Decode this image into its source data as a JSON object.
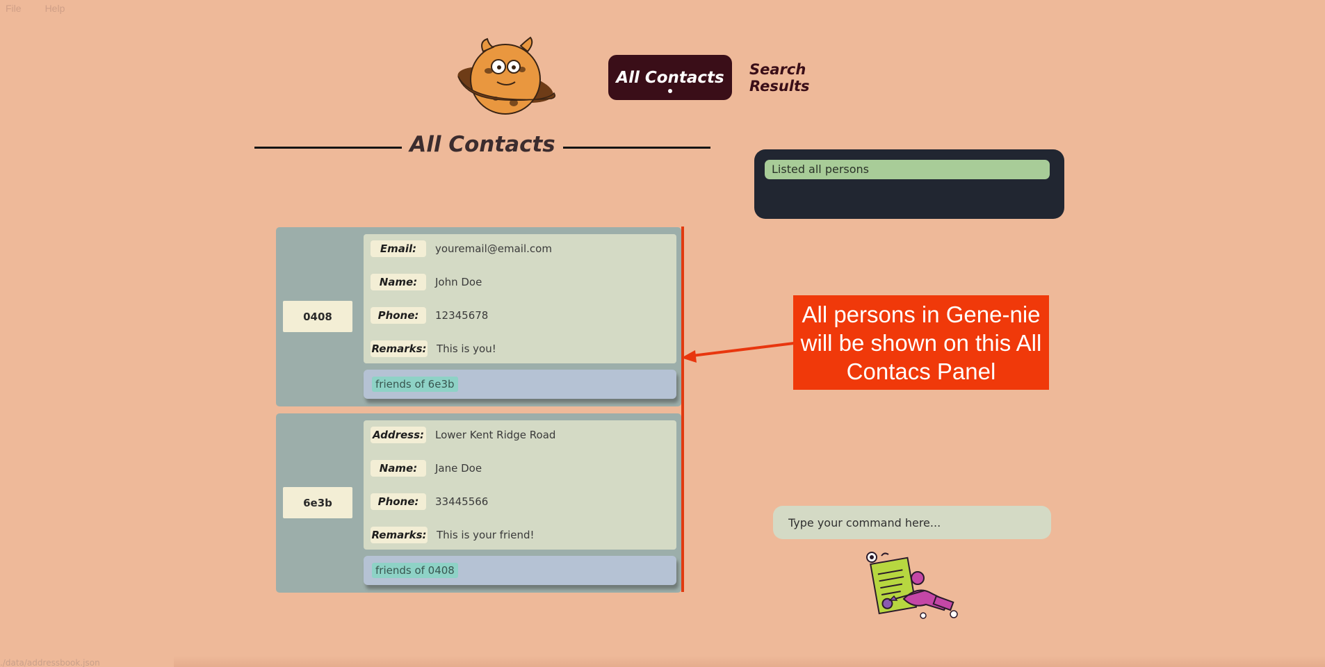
{
  "menu": {
    "items": [
      "File",
      "Help"
    ]
  },
  "nav": {
    "active_tab": "All Contacts",
    "inactive_tab": "Search Results"
  },
  "section": {
    "title": "All Contacts"
  },
  "result_display": {
    "text": "Listed all persons"
  },
  "contacts": [
    {
      "id": "0408",
      "fields": [
        {
          "label": "Email:",
          "value": "youremail@email.com"
        },
        {
          "label": "Name:",
          "value": "John Doe"
        },
        {
          "label": "Phone:",
          "value": "12345678"
        },
        {
          "label": "Remarks:",
          "value": "This is you!"
        }
      ],
      "tag": "friends of 6e3b"
    },
    {
      "id": "6e3b",
      "fields": [
        {
          "label": "Address:",
          "value": "Lower Kent Ridge Road"
        },
        {
          "label": "Name:",
          "value": "Jane Doe"
        },
        {
          "label": "Phone:",
          "value": "33445566"
        },
        {
          "label": "Remarks:",
          "value": "This is your friend!"
        }
      ],
      "tag": "friends of 0408"
    }
  ],
  "annotation": {
    "text": "All persons in Gene-nie will be shown on this All Contacs Panel"
  },
  "command_box": {
    "placeholder": "Type your command here..."
  },
  "status_bar": {
    "path": "./data/addressbook.json"
  },
  "icons": {
    "logo": "planet-cookie-monster-icon",
    "mascot": "notepad-with-quill-mascot-icon",
    "arrow": "arrow-left-icon"
  },
  "colors": {
    "background": "#eeb999",
    "nav_active": "#3a0e18",
    "result_bg": "#212631",
    "result_text_bg": "#a8cc98",
    "card_bg": "#9caeaa",
    "annotation": "#f0390a",
    "panel_border": "#e13a10"
  }
}
